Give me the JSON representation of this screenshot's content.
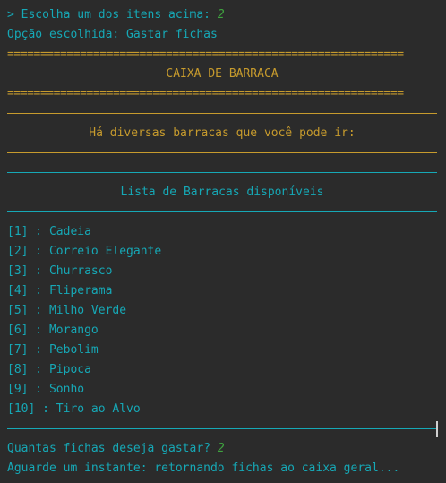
{
  "console": {
    "prompt_label": "> Escolha um dos itens acima: ",
    "prompt_value": "2",
    "chosen_line": "Opção escolhida: Gastar fichas",
    "separator_equals": "============================================================",
    "header_title": "CAIXA DE BARRACA",
    "info_message": "Há diversas barracas que você pode ir:",
    "list_title": "Lista de Barracas disponíveis",
    "stalls": [
      "[1] : Cadeia",
      "[2] : Correio Elegante",
      "[3] : Churrasco",
      "[4] : Fliperama",
      "[5] : Milho Verde",
      "[6] : Morango",
      "[7] : Pebolim",
      "[8] : Pipoca",
      "[9] : Sonho",
      "[10] : Tiro ao Alvo"
    ],
    "question_label": "Quantas fichas deseja gastar? ",
    "question_value": "2",
    "status_line": "Aguarde um instante: retornando fichas ao caixa geral..."
  },
  "colors": {
    "background": "#2b2b2b",
    "cyan_text": "#16a8b6",
    "gold_text": "#c79b2d",
    "user_input_green": "#3fa33f"
  }
}
